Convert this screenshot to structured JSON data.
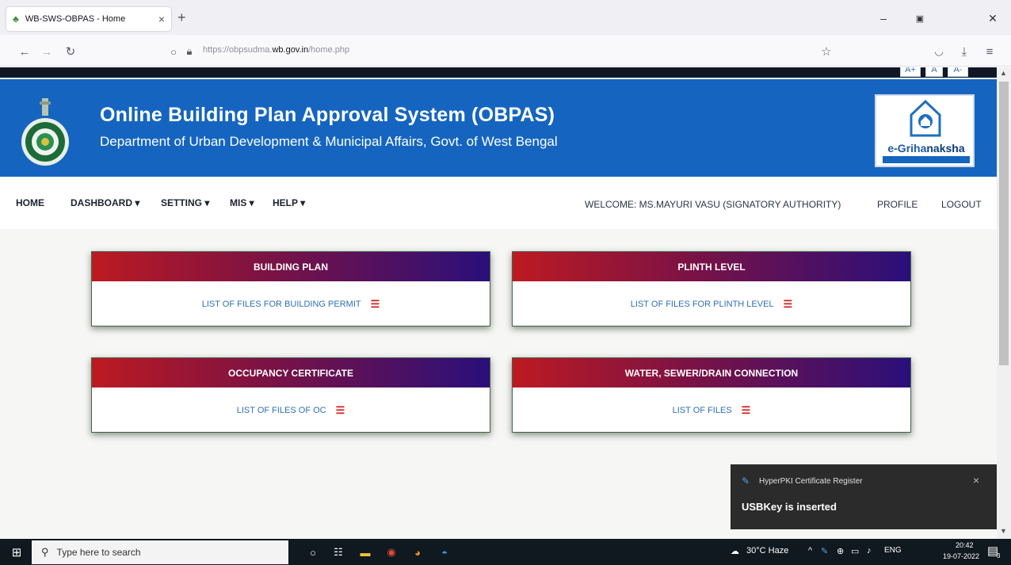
{
  "browser": {
    "tab_title": "WB-SWS-OBPAS - Home",
    "tab_close": "×",
    "new_tab": "+",
    "url_prefix": "https://obpsudma.",
    "url_domain": "wb.gov.in",
    "url_path": "/home.php"
  },
  "font_controls": {
    "increase": "A+",
    "normal": "A",
    "decrease": "A-"
  },
  "header": {
    "title": "Online Building Plan Approval System (OBPAS)",
    "subtitle": "Department of Urban Development & Municipal Affairs, Govt. of West Bengal",
    "logo_text_a": "e-Griha",
    "logo_text_b": "naksha"
  },
  "menu": {
    "home": "HOME",
    "dashboard": "DASHBOARD ▾",
    "setting": "SETTING ▾",
    "mis": "MIS ▾",
    "help": "HELP ▾",
    "welcome": "WELCOME: MS.MAYURI VASU (SIGNATORY AUTHORITY)",
    "profile": "PROFILE",
    "logout": "LOGOUT"
  },
  "cards": [
    {
      "title": "BUILDING PLAN",
      "link": "LIST OF FILES FOR BUILDING PERMIT"
    },
    {
      "title": "PLINTH LEVEL",
      "link": "LIST OF FILES FOR PLINTH LEVEL"
    },
    {
      "title": "OCCUPANCY CERTIFICATE",
      "link": "LIST OF FILES OF OC"
    },
    {
      "title": "WATER, SEWER/DRAIN CONNECTION",
      "link": "LIST OF FILES"
    }
  ],
  "toast": {
    "app": "HyperPKI Certificate Register",
    "message": "USBKey is inserted",
    "close": "×"
  },
  "taskbar": {
    "search_placeholder": "Type here to search",
    "weather": "30°C  Haze",
    "lang": "ENG",
    "time": "20:42",
    "date": "19-07-2022",
    "notification_count": "3"
  },
  "colors": {
    "header_blue": "#1565c0",
    "card_gradient_start": "#bd1a22",
    "card_gradient_end": "#2a0f7a",
    "link_blue": "#2f6fb5",
    "list_icon_red": "#d21c1c"
  }
}
